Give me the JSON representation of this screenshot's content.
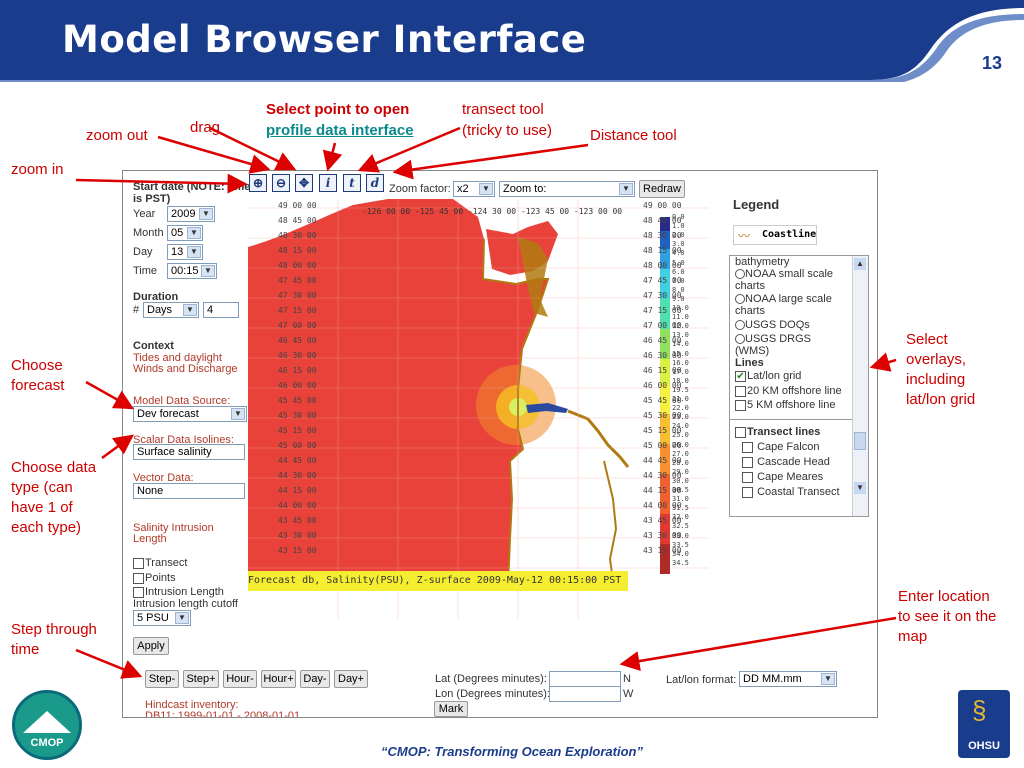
{
  "slide": {
    "title": "Model Browser Interface",
    "number": "13",
    "footer": "“CMOP: Transforming Ocean Exploration”",
    "logo_left": "CMOP",
    "logo_right": "OHSU"
  },
  "annotations": {
    "zoom_out": "zoom out",
    "drag": "drag",
    "select_point_line1": "Select point to open",
    "select_point_line2": "profile data interface",
    "transect_line1": "transect tool",
    "transect_line2": "(tricky to use)",
    "distance": "Distance tool",
    "zoom_in": "zoom in",
    "choose_forecast_1": "Choose",
    "choose_forecast_2": "forecast",
    "choose_type_1": "Choose data",
    "choose_type_2": "type (can",
    "choose_type_3": "have 1 of",
    "choose_type_4": "each type)",
    "step_1": "Step through",
    "step_2": "time",
    "overlays_1": "Select",
    "overlays_2": "overlays,",
    "overlays_3": "including",
    "overlays_4": "lat/lon grid",
    "location_1": "Enter location",
    "location_2": "to see it on the",
    "location_3": "map"
  },
  "app": {
    "start_date": "Start date (NOTE: time is PST)",
    "year_label": "Year",
    "year_value": "2009",
    "month_label": "Month",
    "month_value": "05",
    "day_label": "Day",
    "day_value": "13",
    "time_label": "Time",
    "time_value": "00:15",
    "duration_label": "Duration",
    "duration_hash": "#",
    "duration_unit": "Days",
    "duration_value": "4",
    "context_label": "Context",
    "context_1": "Tides and daylight",
    "context_2": "Winds and Discharge",
    "model_source_label": "Model Data Source:",
    "model_source_value": "Dev forecast",
    "scalar_label": "Scalar Data Isolines:",
    "scalar_value": "Surface salinity",
    "vector_label": "Vector Data:",
    "vector_value": "None",
    "salinity_intrusion_1": "Salinity Intrusion",
    "salinity_intrusion_2": "Length",
    "transect": "Transect",
    "points": "Points",
    "intrusion_length": "Intrusion Length",
    "intrusion_cutoff": "Intrusion length cutoff",
    "cutoff_value": "5 PSU",
    "apply": "Apply",
    "step_buttons": [
      "Step-",
      "Step+",
      "Hour-",
      "Hour+",
      "Day-",
      "Day+"
    ],
    "hindcast_1": "Hindcast inventory:",
    "hindcast_2": "DB11: 1999-01-01 - 2008-01-01",
    "lat_label": "Lat (Degrees minutes):",
    "lat_value": "",
    "lat_dir": "N",
    "lon_label": "Lon (Degrees minutes):",
    "lon_value": "",
    "lon_dir": "W",
    "mark": "Mark",
    "latlon_format_label": "Lat/lon format:",
    "latlon_format_value": "DD MM.mm",
    "zoom_factor_label": "Zoom factor:",
    "zoom_factor_value": "x2",
    "zoom_to_value": "Zoom to:",
    "redraw": "Redraw",
    "tool_icons": [
      "zoom-in-icon",
      "zoom-out-icon",
      "pan-icon",
      "info-icon",
      "transect-icon",
      "distance-icon"
    ],
    "legend_title": "Legend",
    "coastline": "Coastline",
    "overlay_items": {
      "bathymetry": "bathymetry",
      "noaa_small_1": "NOAA small scale",
      "noaa_small_2": "charts",
      "noaa_large_1": "NOAA large scale",
      "noaa_large_2": "charts",
      "usgs_doq": "USGS DOQs",
      "usgs_drg_1": "USGS DRGS",
      "usgs_drg_2": "(WMS)",
      "lines": "Lines",
      "latlon_grid": "Lat/lon grid",
      "km20": "20 KM offshore line",
      "km5": "5 KM offshore line",
      "transect_lines": "Transect lines",
      "cape_falcon": "Cape Falcon",
      "cascade_head": "Cascade Head",
      "cape_meares": "Cape Meares",
      "coastal_transect": "Coastal Transect"
    },
    "map": {
      "lat_labels_left": [
        "49 00 00",
        "48 45 00",
        "48 30 00",
        "48 15 00",
        "48 00 00",
        "47 45 00",
        "47 30 00",
        "47 15 00",
        "47 00 00",
        "46 45 00",
        "46 30 00",
        "46 15 00",
        "46 00 00",
        "45 45 00",
        "45 30 00",
        "45 15 00",
        "45 00 00",
        "44 45 00",
        "44 30 00",
        "44 15 00",
        "44 00 00",
        "43 45 00",
        "43 30 00",
        "43 15 00"
      ],
      "lon_labels": "-126 00 00 -125 45 00 -124 30 00 -123 45 00 -123 00 00",
      "scale_values": [
        "0.0",
        "1.0",
        "2.0",
        "3.0",
        "4.0",
        "5.0",
        "6.0",
        "7.0",
        "8.0",
        "9.0",
        "10.0",
        "11.0",
        "12.0",
        "13.0",
        "14.0",
        "15.0",
        "16.0",
        "17.0",
        "18.0",
        "19.5",
        "21.0",
        "22.0",
        "23.0",
        "24.0",
        "25.0",
        "26.0",
        "27.0",
        "28.0",
        "29.0",
        "30.0",
        "30.5",
        "31.0",
        "31.5",
        "32.0",
        "32.5",
        "33.0",
        "33.5",
        "34.0",
        "34.5"
      ],
      "caption": "Forecast db, Salinity(PSU), Z-surface 2009-May-12 00:15:00 PST",
      "colors": {
        "ocean": "#e8423a",
        "plume": "#f5d020",
        "land": "#ffffff",
        "coast": "#b07a10",
        "caption_bg": "#f5ee30"
      }
    }
  },
  "colors": {
    "header_blue": "#1a3c8c",
    "annotation_red": "#cc0000",
    "arrow_red": "#dd0000"
  }
}
